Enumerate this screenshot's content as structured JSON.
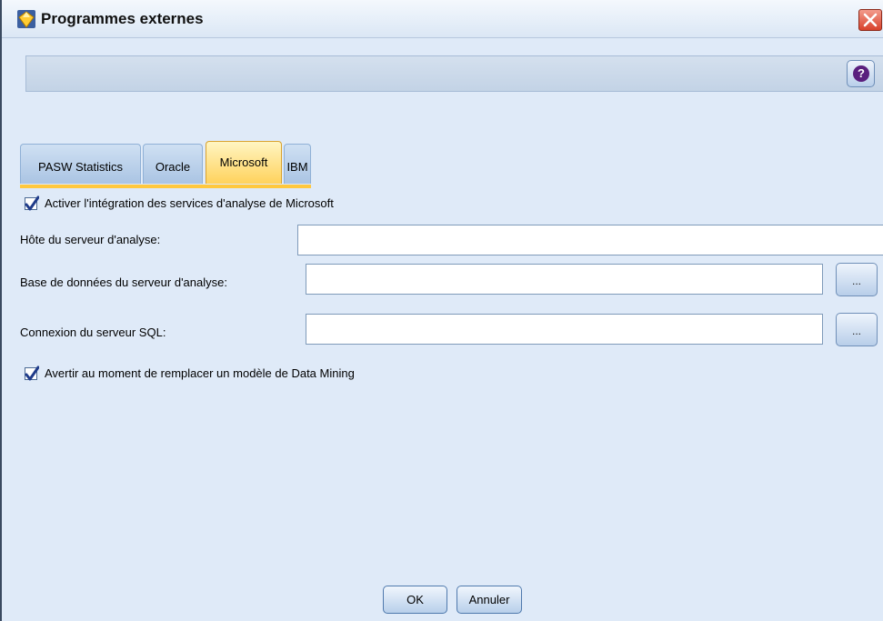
{
  "window": {
    "title": "Programmes externes",
    "app_icon": "diamond-icon",
    "close_icon": "close-icon",
    "help_icon": "help-icon",
    "help_glyph": "?"
  },
  "tabs": [
    {
      "label": "PASW Statistics",
      "active": false
    },
    {
      "label": "Oracle",
      "active": false
    },
    {
      "label": "Microsoft",
      "active": true
    },
    {
      "label": "IBM",
      "active": false
    }
  ],
  "form": {
    "enable_integration": {
      "label": "Activer l'intégration des services d'analyse de Microsoft",
      "checked": true
    },
    "analysis_host": {
      "label": "Hôte du serveur d'analyse:",
      "value": ""
    },
    "analysis_db": {
      "label": "Base de données du serveur d'analyse:",
      "value": "",
      "browse_label": "..."
    },
    "sql_connection": {
      "label": "Connexion du serveur SQL:",
      "value": "",
      "browse_label": "..."
    },
    "warn_replace": {
      "label": "Avertir au moment de remplacer un modèle de Data Mining",
      "checked": true
    }
  },
  "buttons": {
    "ok": "OK",
    "cancel": "Annuler"
  },
  "colors": {
    "active_tab": "#ffd25c",
    "dialog_bg": "#dfeaf8",
    "close_red": "#d8422c"
  }
}
